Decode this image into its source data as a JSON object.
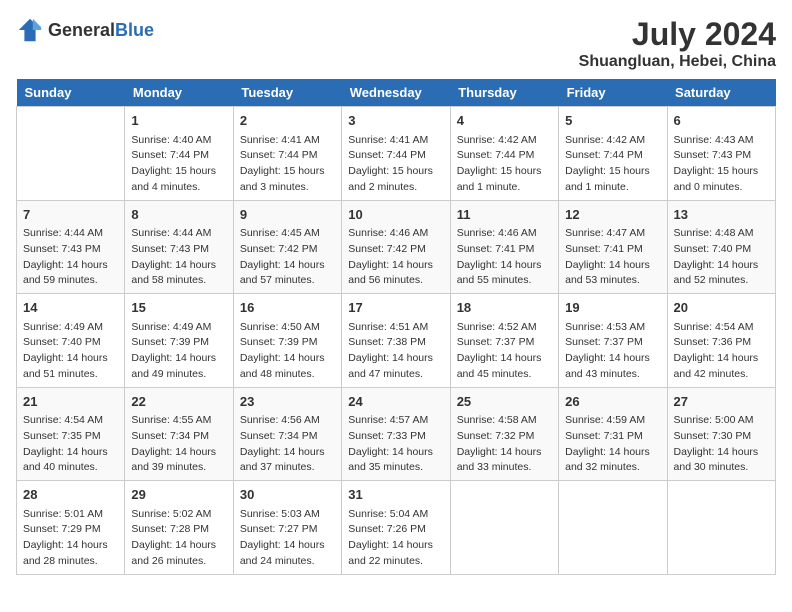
{
  "header": {
    "logo_general": "General",
    "logo_blue": "Blue",
    "month_year": "July 2024",
    "location": "Shuangluan, Hebei, China"
  },
  "calendar": {
    "weekdays": [
      "Sunday",
      "Monday",
      "Tuesday",
      "Wednesday",
      "Thursday",
      "Friday",
      "Saturday"
    ],
    "weeks": [
      [
        {
          "day": "",
          "info": ""
        },
        {
          "day": "1",
          "info": "Sunrise: 4:40 AM\nSunset: 7:44 PM\nDaylight: 15 hours\nand 4 minutes."
        },
        {
          "day": "2",
          "info": "Sunrise: 4:41 AM\nSunset: 7:44 PM\nDaylight: 15 hours\nand 3 minutes."
        },
        {
          "day": "3",
          "info": "Sunrise: 4:41 AM\nSunset: 7:44 PM\nDaylight: 15 hours\nand 2 minutes."
        },
        {
          "day": "4",
          "info": "Sunrise: 4:42 AM\nSunset: 7:44 PM\nDaylight: 15 hours\nand 1 minute."
        },
        {
          "day": "5",
          "info": "Sunrise: 4:42 AM\nSunset: 7:44 PM\nDaylight: 15 hours\nand 1 minute."
        },
        {
          "day": "6",
          "info": "Sunrise: 4:43 AM\nSunset: 7:43 PM\nDaylight: 15 hours\nand 0 minutes."
        }
      ],
      [
        {
          "day": "7",
          "info": "Sunrise: 4:44 AM\nSunset: 7:43 PM\nDaylight: 14 hours\nand 59 minutes."
        },
        {
          "day": "8",
          "info": "Sunrise: 4:44 AM\nSunset: 7:43 PM\nDaylight: 14 hours\nand 58 minutes."
        },
        {
          "day": "9",
          "info": "Sunrise: 4:45 AM\nSunset: 7:42 PM\nDaylight: 14 hours\nand 57 minutes."
        },
        {
          "day": "10",
          "info": "Sunrise: 4:46 AM\nSunset: 7:42 PM\nDaylight: 14 hours\nand 56 minutes."
        },
        {
          "day": "11",
          "info": "Sunrise: 4:46 AM\nSunset: 7:41 PM\nDaylight: 14 hours\nand 55 minutes."
        },
        {
          "day": "12",
          "info": "Sunrise: 4:47 AM\nSunset: 7:41 PM\nDaylight: 14 hours\nand 53 minutes."
        },
        {
          "day": "13",
          "info": "Sunrise: 4:48 AM\nSunset: 7:40 PM\nDaylight: 14 hours\nand 52 minutes."
        }
      ],
      [
        {
          "day": "14",
          "info": "Sunrise: 4:49 AM\nSunset: 7:40 PM\nDaylight: 14 hours\nand 51 minutes."
        },
        {
          "day": "15",
          "info": "Sunrise: 4:49 AM\nSunset: 7:39 PM\nDaylight: 14 hours\nand 49 minutes."
        },
        {
          "day": "16",
          "info": "Sunrise: 4:50 AM\nSunset: 7:39 PM\nDaylight: 14 hours\nand 48 minutes."
        },
        {
          "day": "17",
          "info": "Sunrise: 4:51 AM\nSunset: 7:38 PM\nDaylight: 14 hours\nand 47 minutes."
        },
        {
          "day": "18",
          "info": "Sunrise: 4:52 AM\nSunset: 7:37 PM\nDaylight: 14 hours\nand 45 minutes."
        },
        {
          "day": "19",
          "info": "Sunrise: 4:53 AM\nSunset: 7:37 PM\nDaylight: 14 hours\nand 43 minutes."
        },
        {
          "day": "20",
          "info": "Sunrise: 4:54 AM\nSunset: 7:36 PM\nDaylight: 14 hours\nand 42 minutes."
        }
      ],
      [
        {
          "day": "21",
          "info": "Sunrise: 4:54 AM\nSunset: 7:35 PM\nDaylight: 14 hours\nand 40 minutes."
        },
        {
          "day": "22",
          "info": "Sunrise: 4:55 AM\nSunset: 7:34 PM\nDaylight: 14 hours\nand 39 minutes."
        },
        {
          "day": "23",
          "info": "Sunrise: 4:56 AM\nSunset: 7:34 PM\nDaylight: 14 hours\nand 37 minutes."
        },
        {
          "day": "24",
          "info": "Sunrise: 4:57 AM\nSunset: 7:33 PM\nDaylight: 14 hours\nand 35 minutes."
        },
        {
          "day": "25",
          "info": "Sunrise: 4:58 AM\nSunset: 7:32 PM\nDaylight: 14 hours\nand 33 minutes."
        },
        {
          "day": "26",
          "info": "Sunrise: 4:59 AM\nSunset: 7:31 PM\nDaylight: 14 hours\nand 32 minutes."
        },
        {
          "day": "27",
          "info": "Sunrise: 5:00 AM\nSunset: 7:30 PM\nDaylight: 14 hours\nand 30 minutes."
        }
      ],
      [
        {
          "day": "28",
          "info": "Sunrise: 5:01 AM\nSunset: 7:29 PM\nDaylight: 14 hours\nand 28 minutes."
        },
        {
          "day": "29",
          "info": "Sunrise: 5:02 AM\nSunset: 7:28 PM\nDaylight: 14 hours\nand 26 minutes."
        },
        {
          "day": "30",
          "info": "Sunrise: 5:03 AM\nSunset: 7:27 PM\nDaylight: 14 hours\nand 24 minutes."
        },
        {
          "day": "31",
          "info": "Sunrise: 5:04 AM\nSunset: 7:26 PM\nDaylight: 14 hours\nand 22 minutes."
        },
        {
          "day": "",
          "info": ""
        },
        {
          "day": "",
          "info": ""
        },
        {
          "day": "",
          "info": ""
        }
      ]
    ]
  }
}
